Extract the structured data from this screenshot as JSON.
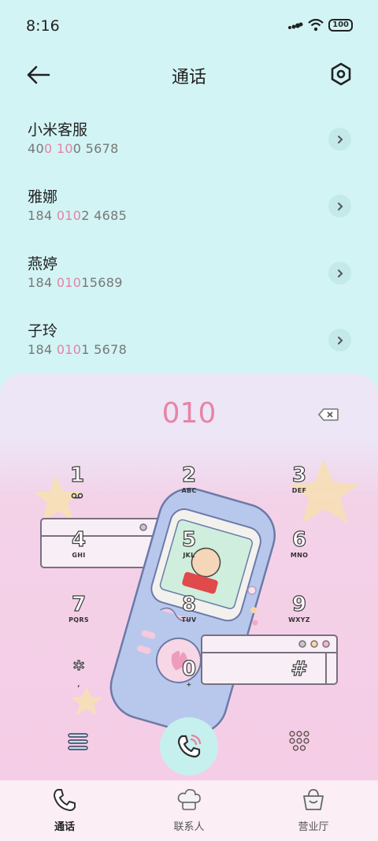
{
  "status": {
    "time": "8:16",
    "battery": "100"
  },
  "header": {
    "title": "通话"
  },
  "contacts": [
    {
      "name": "小米客服",
      "pre": "40",
      "hl": "0 10",
      "post": "0 5678"
    },
    {
      "name": "雅娜",
      "pre": "184 ",
      "hl": "010",
      "post": "2 4685"
    },
    {
      "name": "燕婷",
      "pre": "184 ",
      "hl": "010",
      "post": "15689"
    },
    {
      "name": "子玲",
      "pre": "184 ",
      "hl": "010",
      "post": "1 5678"
    }
  ],
  "dialer": {
    "input": "010",
    "keys": [
      {
        "digit": "1",
        "letters": ""
      },
      {
        "digit": "2",
        "letters": "ABC"
      },
      {
        "digit": "3",
        "letters": "DEF"
      },
      {
        "digit": "4",
        "letters": "GHI"
      },
      {
        "digit": "5",
        "letters": "JKL"
      },
      {
        "digit": "6",
        "letters": "MNO"
      },
      {
        "digit": "7",
        "letters": "PQRS"
      },
      {
        "digit": "8",
        "letters": "TUV"
      },
      {
        "digit": "9",
        "letters": "WXYZ"
      },
      {
        "digit": "*",
        "letters": ","
      },
      {
        "digit": "0",
        "letters": "+"
      },
      {
        "digit": "#",
        "letters": ""
      }
    ]
  },
  "tabs": [
    {
      "label": "通话",
      "icon": "phone-icon",
      "active": true
    },
    {
      "label": "联系人",
      "icon": "chef-hat-icon",
      "active": false
    },
    {
      "label": "营业厅",
      "icon": "basket-icon",
      "active": false
    }
  ],
  "colors": {
    "accent": "#e784a5",
    "background": "#d3f4f4",
    "call_button": "#c5f0ee"
  }
}
